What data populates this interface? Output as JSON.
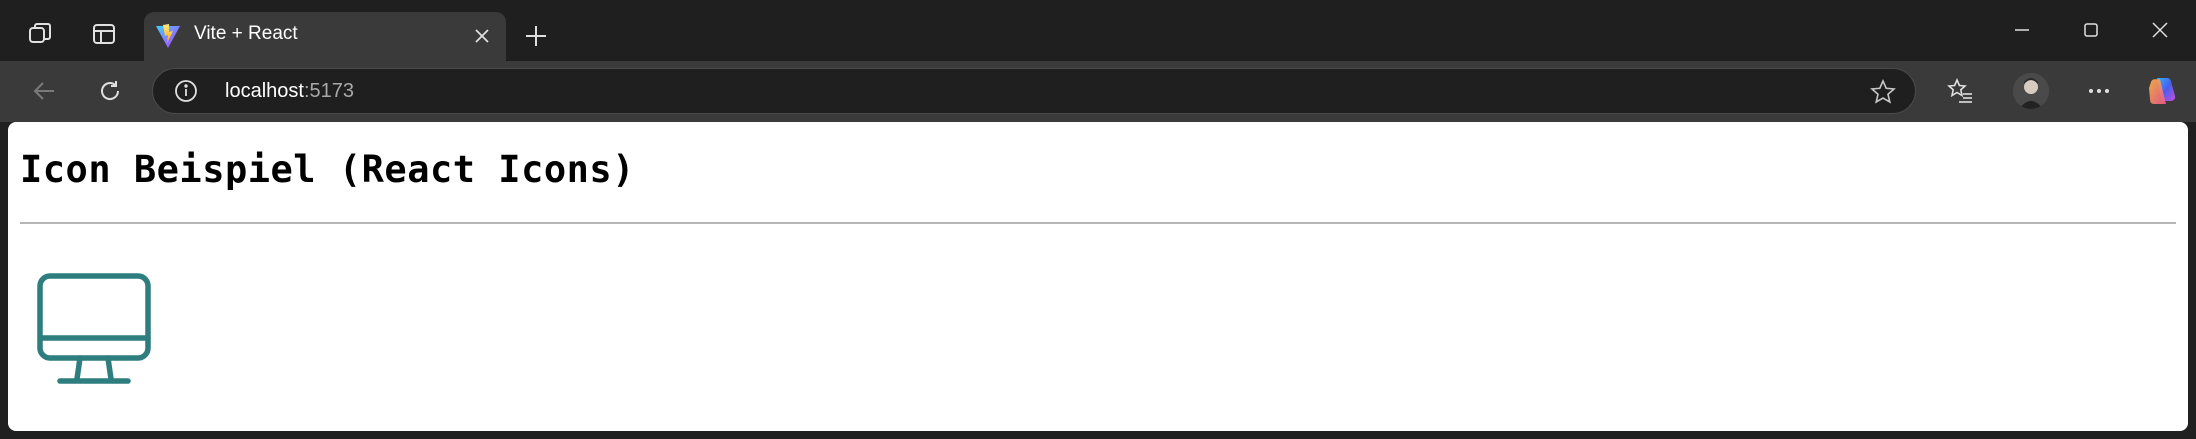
{
  "browser": {
    "tab": {
      "title": "Vite + React",
      "favicon": "vite-logo-icon"
    },
    "address": {
      "host": "localhost",
      "port": ":5173"
    },
    "icons": {
      "workspaces": "workspaces-icon",
      "tab_actions": "tab-actions-icon",
      "close_tab": "close-icon",
      "new_tab": "plus-icon",
      "back": "arrow-left-icon",
      "refresh": "refresh-icon",
      "site_info": "info-icon",
      "favorite": "star-icon",
      "favorites": "favorites-list-icon",
      "profile": "avatar",
      "more": "more-icon",
      "copilot": "copilot-icon",
      "minimize": "minimize-icon",
      "maximize": "maximize-icon",
      "close_window": "close-icon"
    },
    "colors": {
      "titlebar": "#1f1f1f",
      "toolbar": "#3a3a3a",
      "omnibox": "#1f1f1f"
    }
  },
  "page": {
    "heading": "Icon Beispiel (React Icons)",
    "icon": "monitor-icon",
    "icon_color": "#2e7d7f",
    "divider_color": "#b5b5b5"
  }
}
